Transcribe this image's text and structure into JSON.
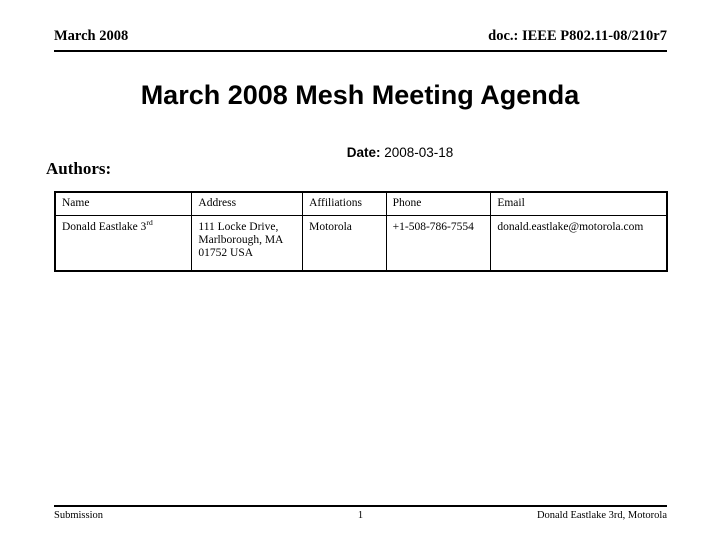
{
  "header": {
    "left": "March 2008",
    "right": "doc.: IEEE P802.11-08/210r7"
  },
  "title": "March 2008 Mesh Meeting Agenda",
  "authors_section": {
    "label": "Authors:",
    "date_key": "Date:",
    "date_value": "2008-03-18"
  },
  "authors_table": {
    "columns": [
      "Name",
      "Address",
      "Affiliations",
      "Phone",
      "Email"
    ],
    "rows": [
      {
        "name_main": "Donald Eastlake 3",
        "name_ordinal": "rd",
        "address": "111 Locke Drive, Marlborough, MA 01752 USA",
        "address_line1": "111 Locke Drive,",
        "address_line2": "Marlborough, MA",
        "address_line3": "01752 USA",
        "affiliations": "Motorola",
        "phone": "+1-508-786-7554",
        "email": "donald.eastlake@motorola.com"
      }
    ]
  },
  "footer": {
    "left": "Submission",
    "center": "1",
    "right": "Donald Eastlake 3rd, Motorola"
  }
}
